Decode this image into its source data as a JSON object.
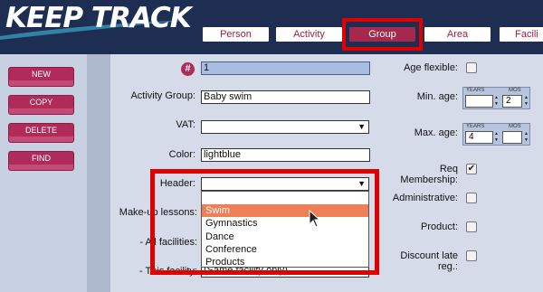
{
  "app": {
    "logo": "KEEP TRACK"
  },
  "tabs": [
    {
      "label": "Person",
      "active": false
    },
    {
      "label": "Activity",
      "active": false
    },
    {
      "label": "Group",
      "active": true
    },
    {
      "label": "Area",
      "active": false
    },
    {
      "label": "Facili",
      "active": false
    }
  ],
  "commands": {
    "new": "NEW",
    "copy": "COPY",
    "delete": "DELETE",
    "find": "FIND"
  },
  "form": {
    "id_value": "1",
    "activity_group_label": "Activity Group:",
    "activity_group_value": "Baby swim",
    "vat_label": "VAT:",
    "vat_value": "",
    "color_label": "Color:",
    "color_value": "lightblue",
    "header_label": "Header:",
    "header_value": "",
    "makeup_label": "Make-up lessons:",
    "all_facilities_label": "- All facilities:",
    "this_facility_label": "- This facility:",
    "this_facility_value": "(Same facility only)",
    "age_flexible_label": "Age flexible:",
    "min_age_label": "Min. age:",
    "max_age_label": "Max. age:",
    "req_membership_label": "Req Membership:",
    "administrative_label": "Administrative:",
    "product_label": "Product:",
    "discount_label": "Discount late reg.:",
    "years_header": "YEARS",
    "mos_header": "MOS",
    "min_age_years": "",
    "min_age_mos": "2",
    "max_age_years": "4",
    "max_age_mos": ""
  },
  "checkboxes": {
    "age_flexible": false,
    "req_membership": true,
    "administrative": false,
    "product": false,
    "discount_late_reg": false
  },
  "header_dropdown": {
    "options": [
      "",
      "Swim",
      "Gymnastics",
      "Dance",
      "Conference",
      "Products"
    ],
    "selected": "Swim"
  },
  "colors": {
    "brand_dark": "#1e2d52",
    "accent": "#b12b5a",
    "highlight": "#ef7f56",
    "annotation": "#e00000"
  }
}
